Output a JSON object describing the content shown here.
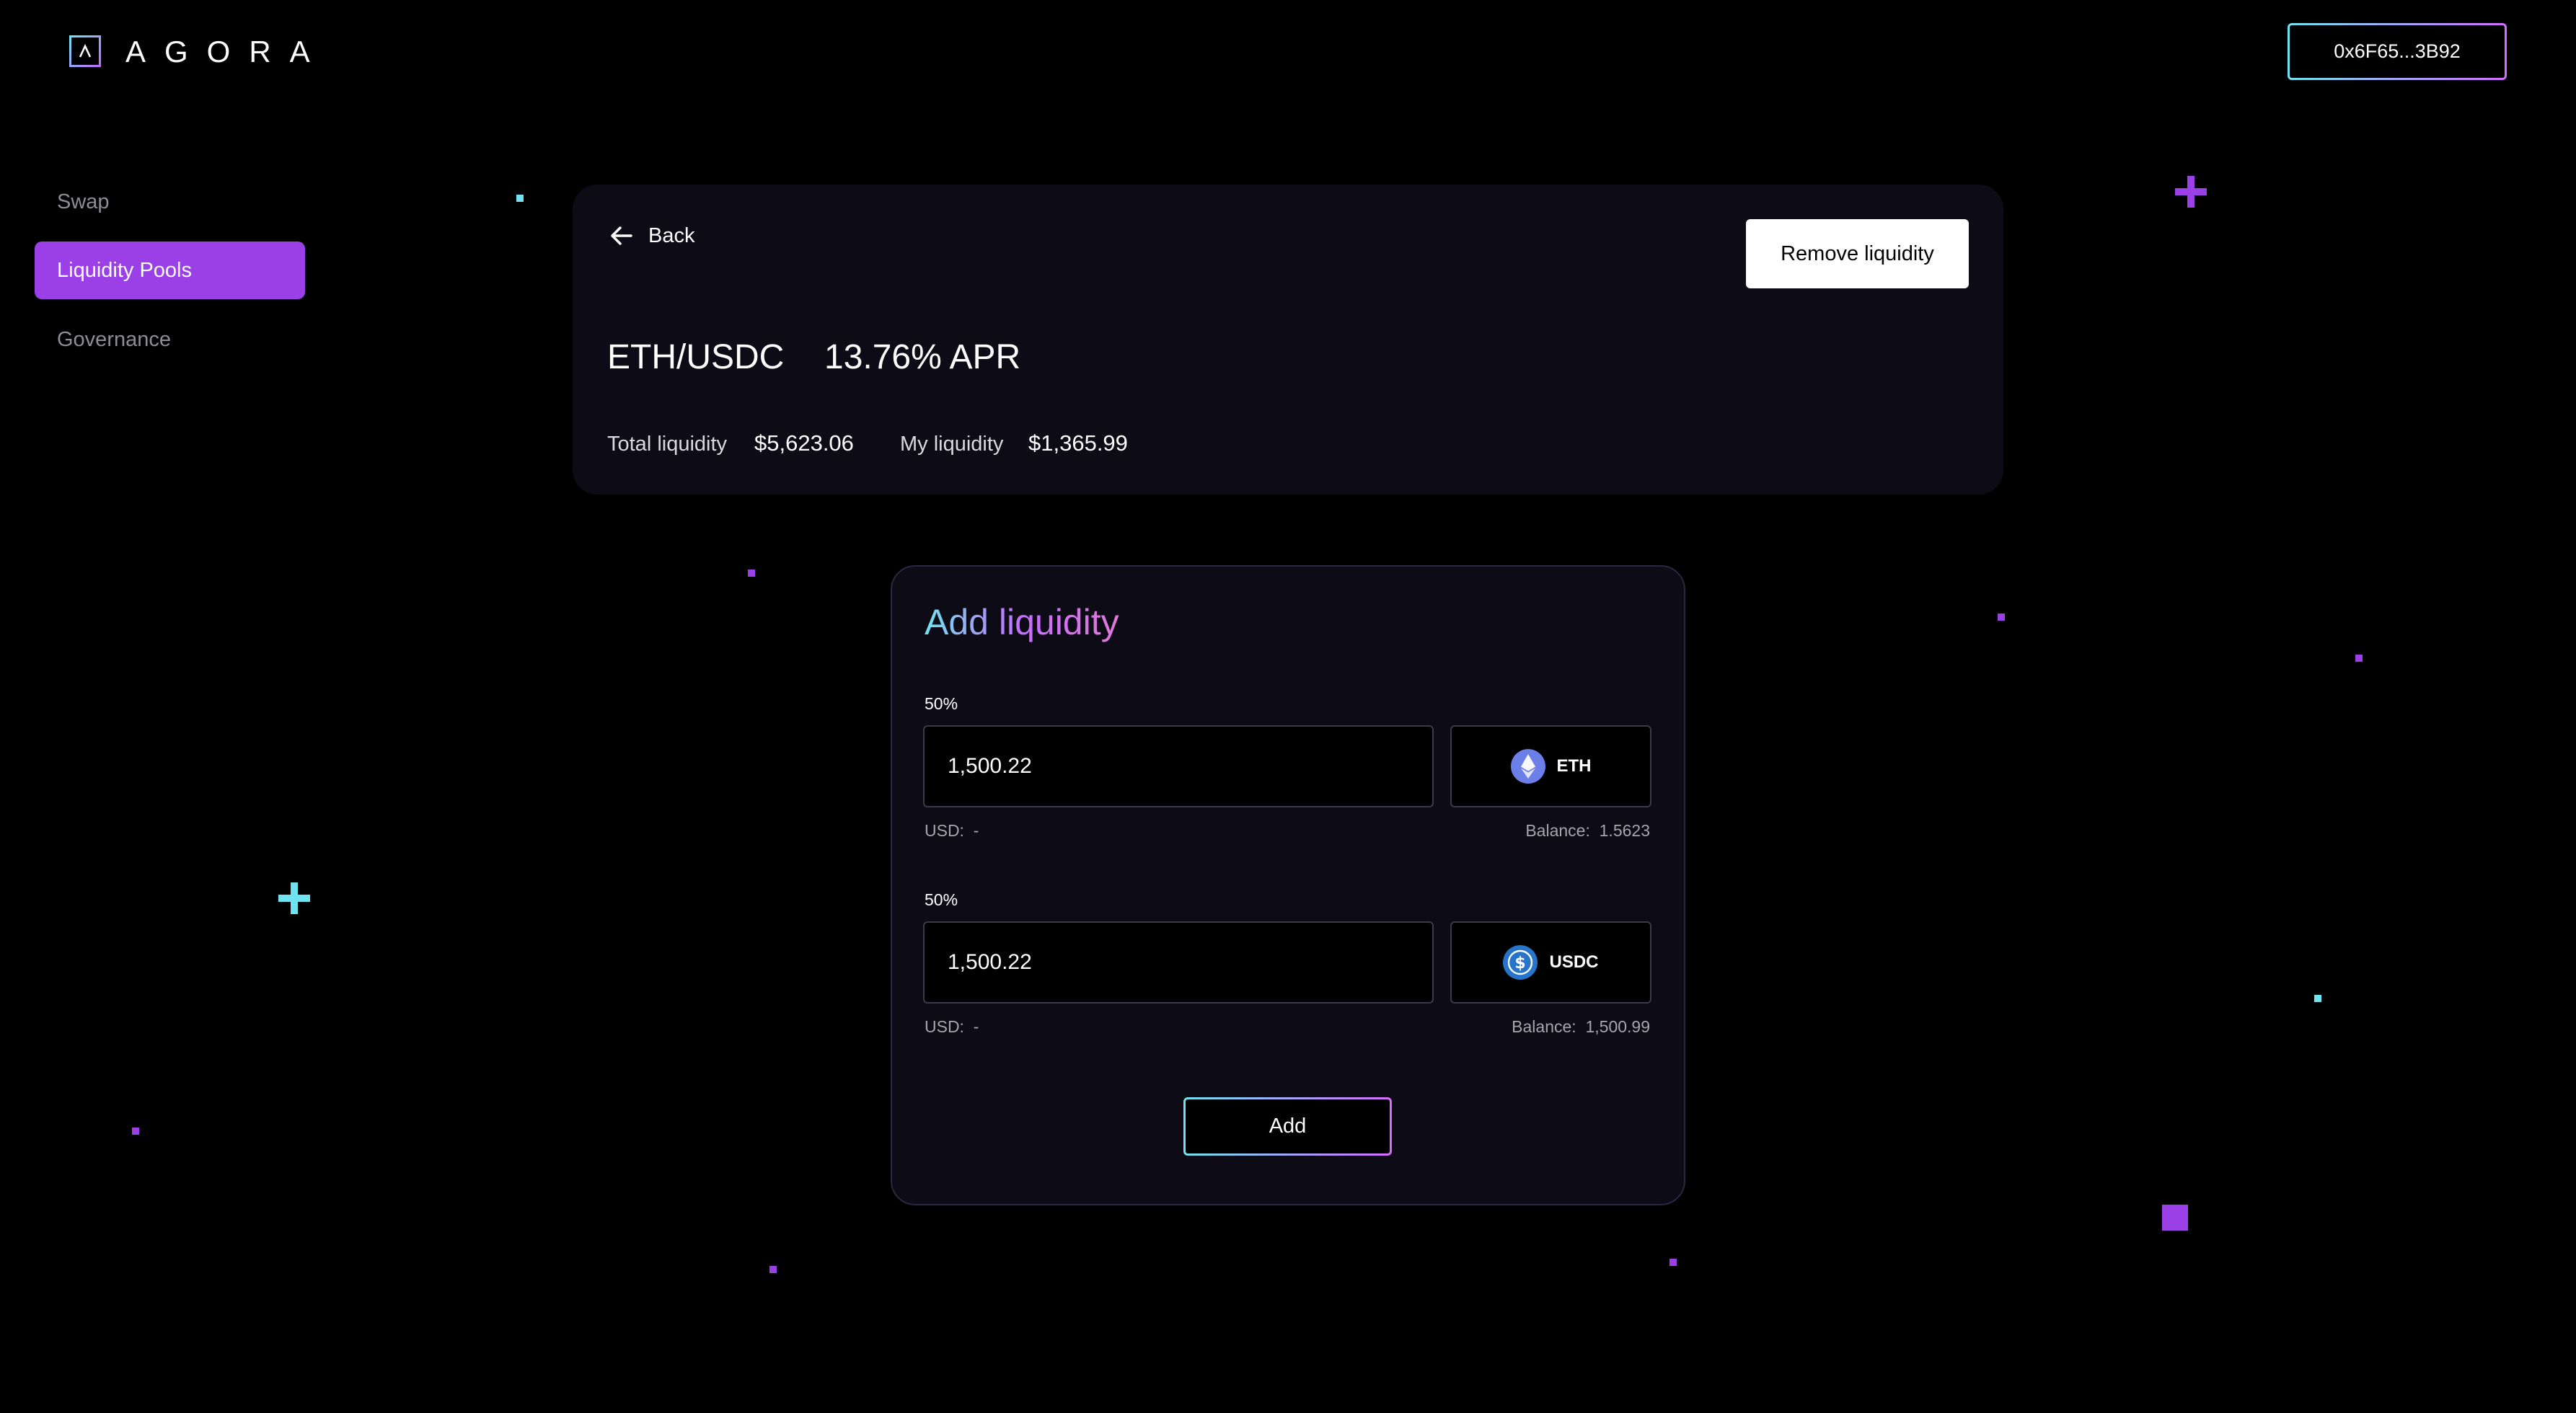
{
  "app": {
    "brand": "AGORA"
  },
  "wallet": {
    "address": "0x6F65...3B92"
  },
  "sidebar": {
    "items": [
      {
        "label": "Swap",
        "active": false
      },
      {
        "label": "Liquidity Pools",
        "active": true
      },
      {
        "label": "Governance",
        "active": false
      }
    ]
  },
  "pool": {
    "back_label": "Back",
    "remove_label": "Remove liquidity",
    "pair": "ETH/USDC",
    "apr": "13.76% APR",
    "total_label": "Total liquidity",
    "total_value": "$5,623.06",
    "my_label": "My liquidity",
    "my_value": "$1,365.99"
  },
  "add": {
    "title": "Add liquidity",
    "rows": [
      {
        "percent": "50%",
        "amount": "1,500.22",
        "token": "ETH",
        "token_icon": "eth-icon",
        "usd_label": "USD:",
        "usd_value": "-",
        "balance_label": "Balance:",
        "balance_value": "1.5623"
      },
      {
        "percent": "50%",
        "amount": "1,500.22",
        "token": "USDC",
        "token_icon": "usdc-icon",
        "usd_label": "USD:",
        "usd_value": "-",
        "balance_label": "Balance:",
        "balance_value": "1,500.99"
      }
    ],
    "button_label": "Add"
  },
  "colors": {
    "accent": "#9b3fe6",
    "cyan": "#6fe3f0",
    "card": "#0d0c16",
    "background": "#000000"
  }
}
